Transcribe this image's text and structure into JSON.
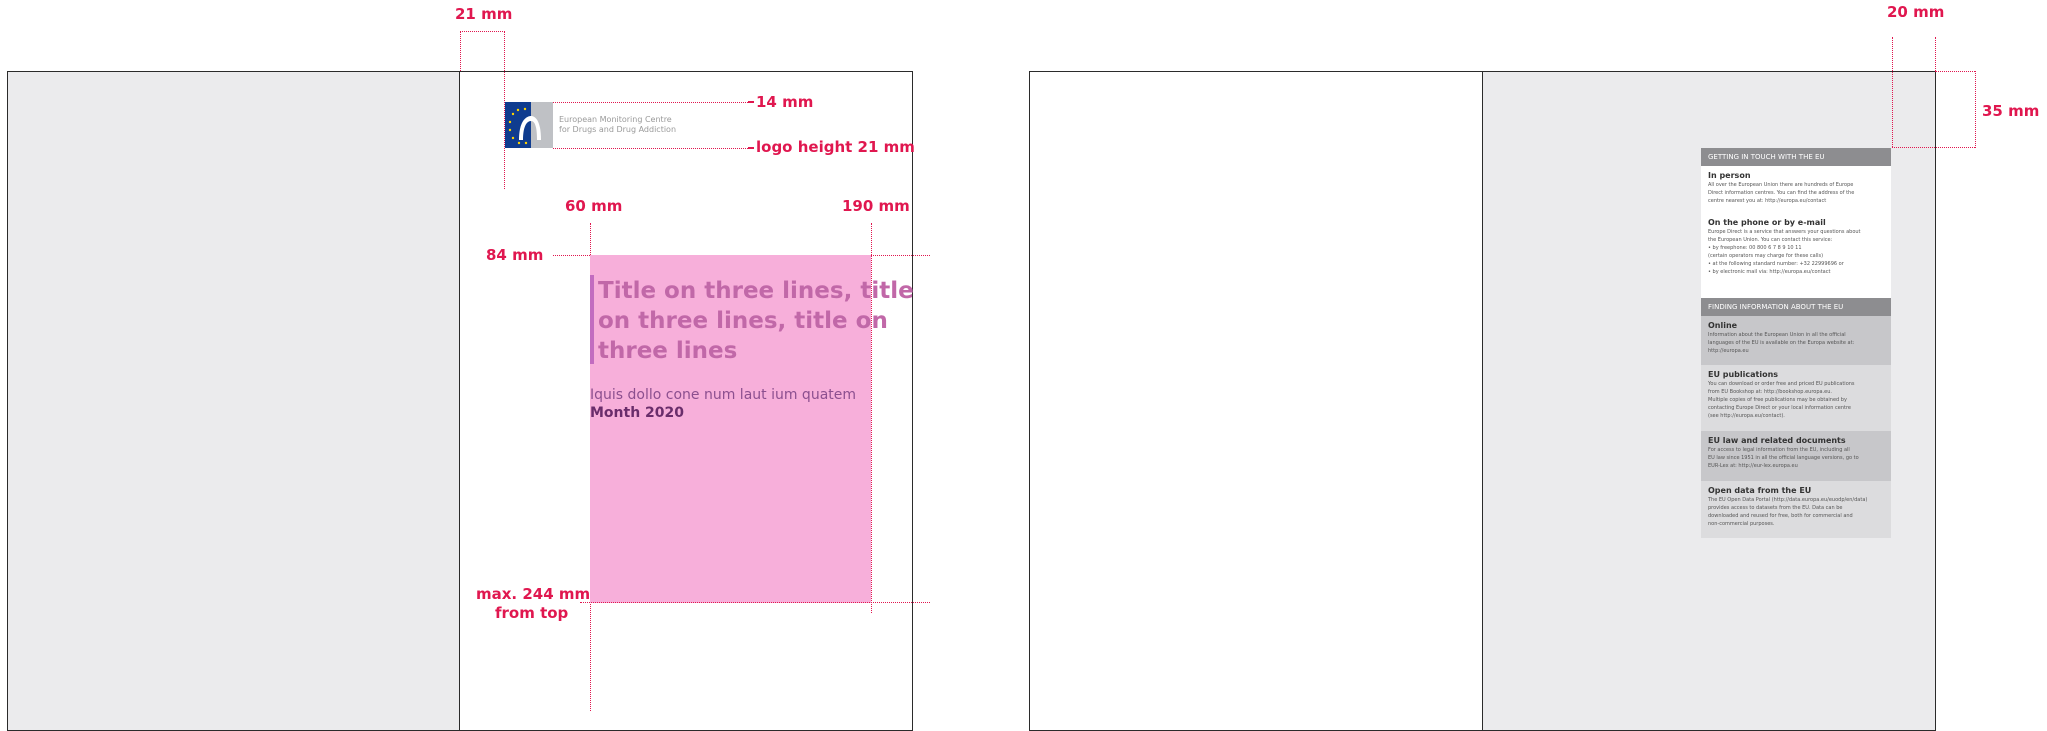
{
  "dimensions": {
    "top_margin_left": "21 mm",
    "logo_top": "14 mm",
    "logo_height": "logo height 21 mm",
    "left_col": "60 mm",
    "right_col": "190 mm",
    "title_top": "84 mm",
    "max_bottom": [
      "max. 244 mm",
      "from top"
    ],
    "right_margin": "20 mm",
    "top_margin_right": "35 mm"
  },
  "logo": {
    "lines": [
      "European Monitoring Centre",
      "for Drugs and Drug Addiction"
    ]
  },
  "front_cover": {
    "title_lines": [
      "Title on three lines, title",
      "on three lines, title on",
      "three lines"
    ],
    "subtitle": "Iquis dollo cone num laut ium quatem",
    "date": "Month 2020"
  },
  "back_cover": {
    "sections": [
      {
        "heading": "GETTING IN TOUCH WITH THE EU",
        "blocks": [
          {
            "title": "In person",
            "lines": [
              "All over the European Union there are hundreds of Europe",
              "Direct information centres. You can find the address of the",
              "centre nearest you at: http://europa.eu/contact"
            ]
          },
          {
            "title": "On the phone or by e-mail",
            "lines": [
              "Europe Direct is a service that answers your questions about",
              "the European Union. You can contact this service:",
              "• by freephone: 00 800 6 7 8 9 10 11",
              "   (certain operators may charge for these calls)",
              "• at the following standard number: +32 22999696 or",
              "• by electronic mail via: http://europa.eu/contact"
            ]
          }
        ]
      },
      {
        "heading": "FINDING INFORMATION ABOUT THE EU",
        "blocks": [
          {
            "title": "Online",
            "lines": [
              "Information about the European Union in all the official",
              "languages of the EU is available on the Europa website at:",
              "http://europa.eu"
            ]
          },
          {
            "title": "EU publications",
            "lines": [
              "You can download or order free and priced EU publications",
              "from EU Bookshop at: http://bookshop.europa.eu.",
              "Multiple copies of free publications may be obtained by",
              "contacting Europe Direct or your local information centre",
              "(see http://europa.eu/contact)."
            ]
          },
          {
            "title": "EU law and related documents",
            "lines": [
              "For access to legal information from the EU, including all",
              "EU law since 1951 in all the official language versions, go to",
              "EUR-Lex at: http://eur-lex.europa.eu"
            ]
          },
          {
            "title": "Open data from the EU",
            "lines": [
              "The EU Open Data Portal (http://data.europa.eu/euodp/en/data)",
              "provides access to datasets from the EU. Data can be",
              "downloaded and reused for free, both for commercial and",
              "non-commercial purposes."
            ]
          }
        ]
      }
    ]
  },
  "colors": {
    "dimension": "#e0174f",
    "title_area": "#f7afda",
    "title_bar": "#c26cc0",
    "page_gray": "#ebebed",
    "logo_blue": "#0f3c8f",
    "info_header": "#8d8d90"
  }
}
